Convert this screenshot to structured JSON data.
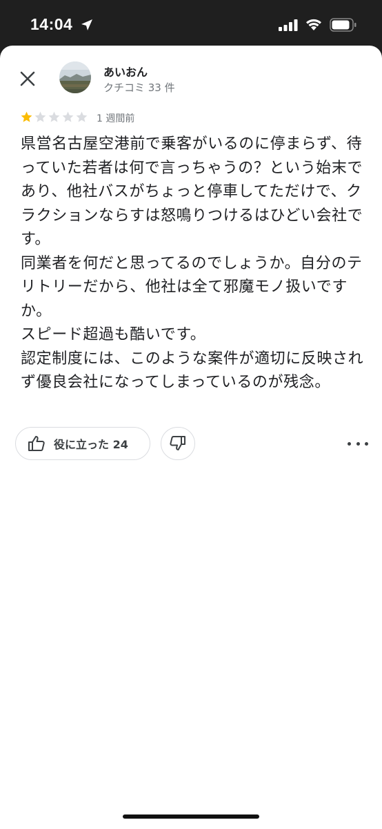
{
  "status_bar": {
    "time": "14:04",
    "icons": [
      "location-arrow-icon",
      "cellular-signal-icon",
      "wifi-icon",
      "battery-icon"
    ]
  },
  "review": {
    "author_name": "あいおん",
    "author_meta": "クチコミ 33 件",
    "rating": 1,
    "rating_max": 5,
    "date": "1 週間前",
    "text": "県営名古屋空港前で乗客がいるのに停まらず、待っていた若者は何で言っちゃうの？という始末であり、他社バスがちょっと停車してただけで、クラクションならすは怒鳴りつけるはひどい会社です。\n同業者を何だと思ってるのでしょうか。自分のテリトリーだから、他社は全て邪魔モノ扱いですか。\nスピード超過も酷いです。\n認定制度には、このような案件が適切に反映されず優良会社になってしまっているのが残念。"
  },
  "actions": {
    "helpful_label": "役に立った 24"
  },
  "colors": {
    "star_filled": "#fbbc04",
    "star_empty": "#dadce0",
    "text_primary": "#202124",
    "text_secondary": "#70757a"
  }
}
